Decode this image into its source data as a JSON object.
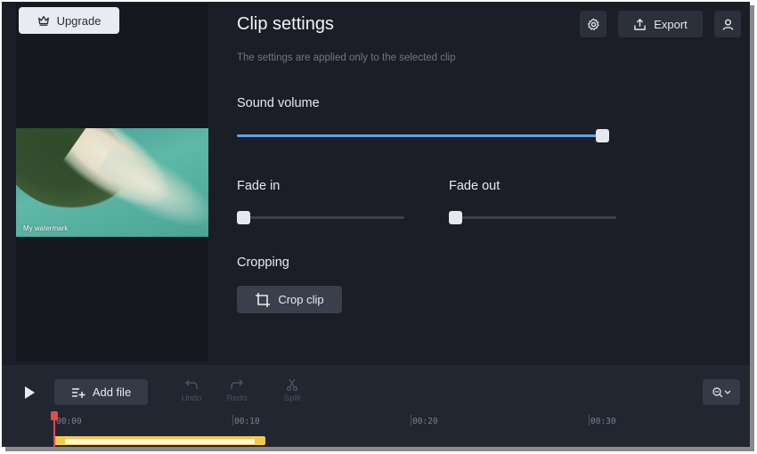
{
  "header": {
    "upgrade_label": "Upgrade",
    "export_label": "Export"
  },
  "preview": {
    "watermark": "My watermark"
  },
  "settings": {
    "title": "Clip settings",
    "subtitle": "The settings are applied only to the selected clip",
    "sound_volume": {
      "label": "Sound volume",
      "value": 1.0
    },
    "fade_in": {
      "label": "Fade in",
      "value": 0.0
    },
    "fade_out": {
      "label": "Fade out",
      "value": 0.0
    },
    "cropping": {
      "label": "Cropping",
      "button_label": "Crop clip"
    }
  },
  "timeline": {
    "add_file_label": "Add file",
    "tools": {
      "undo": "Undo",
      "redo": "Redo",
      "split": "Split"
    },
    "ruler": [
      "00:00",
      "00:10",
      "00:20",
      "00:30"
    ]
  },
  "colors": {
    "accent": "#5aa6e8",
    "clip": "#f3c94a",
    "playhead": "#e34b4b",
    "background": "#1b1e26"
  },
  "icons": {
    "upgrade": "crown-icon",
    "settings": "gear-icon",
    "export": "upload-icon",
    "account": "user-icon",
    "crop": "crop-icon",
    "play": "play-icon",
    "add_file": "add-list-icon",
    "undo": "undo-icon",
    "redo": "redo-icon",
    "split": "scissors-icon",
    "zoom": "zoom-dropdown-icon"
  }
}
